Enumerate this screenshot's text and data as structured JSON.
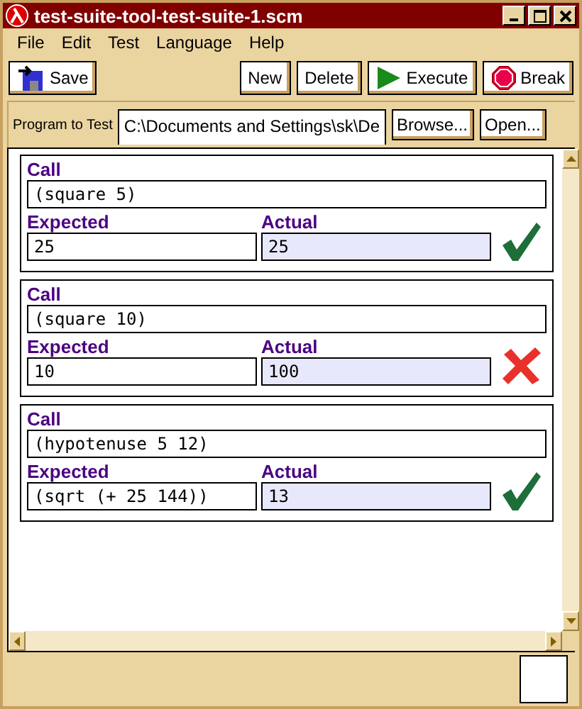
{
  "window": {
    "title": "test-suite-tool-test-suite-1.scm"
  },
  "menu": [
    "File",
    "Edit",
    "Test",
    "Language",
    "Help"
  ],
  "toolbar": {
    "save": "Save",
    "new": "New",
    "delete": "Delete",
    "execute": "Execute",
    "break": "Break"
  },
  "program": {
    "label": "Program to Test",
    "value": "C:\\Documents and Settings\\sk\\De",
    "browse": "Browse...",
    "open": "Open..."
  },
  "tests": [
    {
      "call_label": "Call",
      "call": "(square 5)",
      "expected_label": "Expected",
      "expected": "25",
      "actual_label": "Actual",
      "actual": "25",
      "passed": true
    },
    {
      "call_label": "Call",
      "call": "(square 10)",
      "expected_label": "Expected",
      "expected": "10",
      "actual_label": "Actual",
      "actual": "100",
      "passed": false
    },
    {
      "call_label": "Call",
      "call": "(hypotenuse 5 12)",
      "expected_label": "Expected",
      "expected": "(sqrt (+ 25 144))",
      "actual_label": "Actual",
      "actual": "13",
      "passed": true
    }
  ]
}
